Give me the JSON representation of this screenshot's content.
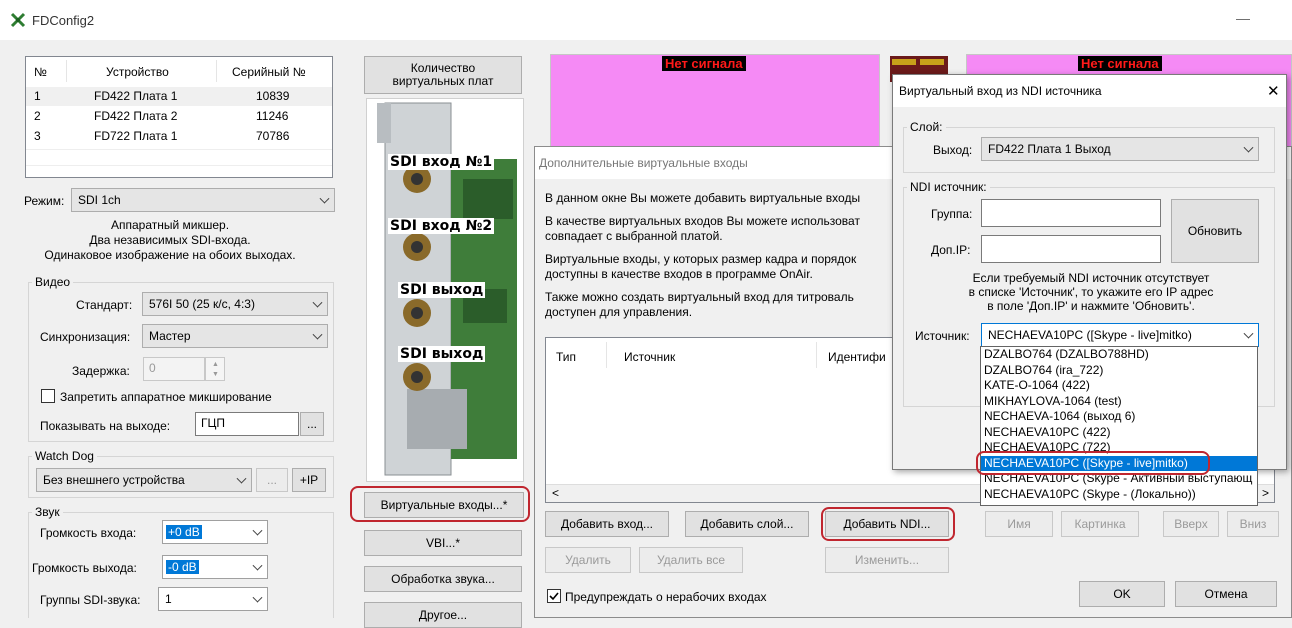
{
  "window": {
    "title": "FDConfig2",
    "minimize": "—"
  },
  "device_table": {
    "headers": [
      "№",
      "Устройство",
      "Серийный №"
    ],
    "rows": [
      [
        "1",
        "FD422 Плата 1",
        "10839"
      ],
      [
        "2",
        "FD422 Плата 2",
        "11246"
      ],
      [
        "3",
        "FD722 Плата 1",
        "70786"
      ]
    ]
  },
  "mode": {
    "label": "Режим:",
    "value": "SDI 1ch",
    "description": [
      "Аппаратный микшер.",
      "Два независимых SDI-входа.",
      "Одинаковое изображение на обоих выходах."
    ]
  },
  "video": {
    "title": "Видео",
    "standard_label": "Стандарт:",
    "standard_value": "576I 50 (25 к/с, 4:3)",
    "sync_label": "Синхронизация:",
    "sync_value": "Мастер",
    "delay_label": "Задержка:",
    "delay_value": "0",
    "disable_mix_label": "Запретить аппаратное микширование",
    "show_on_output_label": "Показывать на выходе:",
    "show_on_output_value": "ГЦП",
    "ellipsis": "..."
  },
  "watchdog": {
    "title": "Watch Dog",
    "value": "Без внешнего устройства",
    "ellipsis": "...",
    "ip_button": "+IP"
  },
  "sound": {
    "title": "Звук",
    "input_volume_label": "Громкость входа:",
    "input_volume_value": "+0 dB",
    "output_volume_label": "Громкость выхода:",
    "output_volume_value": "-0 dB",
    "sdi_groups_label": "Группы SDI-звука:",
    "sdi_groups_value": "1"
  },
  "middle_buttons": {
    "virtual_boards": "Количество виртуальных плат",
    "virtual_inputs": "Виртуальные входы...*",
    "vbi": "VBI...*",
    "sound_processing": "Обработка звука...",
    "other": "Другое..."
  },
  "card_labels": [
    "SDI вход №1",
    "SDI вход №2",
    "SDI выход",
    "SDI выход"
  ],
  "previews": {
    "no_signal": "Нет сигнала"
  },
  "vi_dialog": {
    "title": "Дополнительные виртуальные входы",
    "text1": "В данном окне Вы можете добавить виртуальные входы",
    "text2a": "В качестве виртуальных входов Вы можете использоват",
    "text2b": "совпадает с выбранной платой.",
    "text3a": "Виртуальные входы, у которых размер кадра и порядок",
    "text3b": "доступны в качестве входов в программе OnAir.",
    "text4a": "Также можно создать виртуальный вход для титроваль",
    "text4b": "доступен для управления.",
    "columns": [
      "Тип",
      "Источник",
      "Идентифи"
    ],
    "buttons": {
      "add_input": "Добавить вход...",
      "add_layer": "Добавить слой...",
      "add_ndi": "Добавить NDI...",
      "name": "Имя",
      "picture": "Картинка",
      "up": "Вверх",
      "down": "Вниз",
      "delete": "Удалить",
      "delete_all": "Удалить все",
      "change": "Изменить...",
      "ok": "OK",
      "cancel": "Отмена"
    },
    "warn_label": "Предупреждать о нерабочих входах",
    "warn_checked": true
  },
  "ndi_dialog": {
    "title": "Виртуальный вход из NDI источника",
    "close": "✕",
    "layer_title": "Слой:",
    "output_label": "Выход:",
    "output_value": "FD422 Плата 1 Выход",
    "ndi_title": "NDI источник:",
    "group_label": "Группа:",
    "group_value": "",
    "ip_label": "Доп.IP:",
    "ip_value": "",
    "refresh": "Обновить",
    "hint": [
      "Если требуемый NDI источник отсутствует",
      "в списке 'Источник', то укажите его IP адрес",
      "в поле 'Доп.IP' и нажмите 'Обновить'."
    ],
    "source_label": "Источник:",
    "source_value": "NECHAEVA10PC ([Skype - live]mitko)",
    "options": [
      "DZALBO764 (DZALBO788HD)",
      "DZALBO764 (ira_722)",
      "KATE-O-1064 (422)",
      "MIKHAYLOVA-1064 (test)",
      "NECHAEVA-1064 (выход 6)",
      "NECHAEVA10PC (422)",
      "NECHAEVA10PC (722)",
      "NECHAEVA10PC ([Skype - live]mitko)",
      "NECHAEVA10PC (Skype - Активный выступающ",
      "NECHAEVA10PC (Skype - (Локально))"
    ],
    "selected_index": 7
  },
  "colors": {
    "preview_pink": "#f58af5",
    "selection_blue": "#0078d7",
    "annotation_red": "#c0262f",
    "no_signal_red": "#ff1a1a"
  }
}
